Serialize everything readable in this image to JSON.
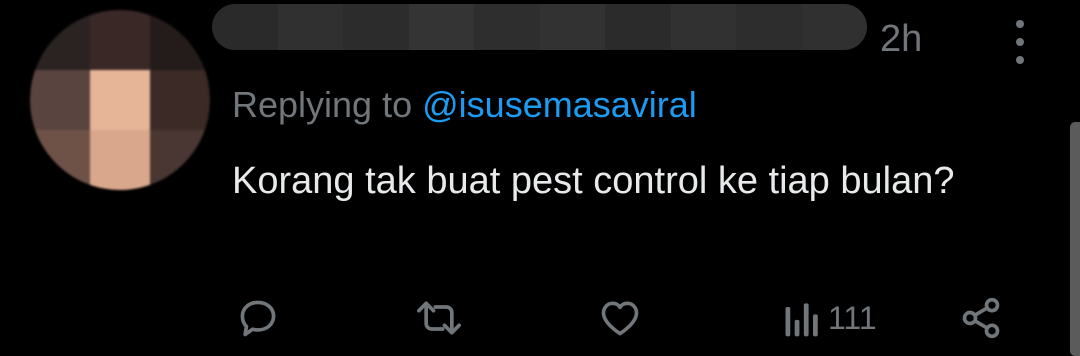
{
  "tweet": {
    "time": "2h",
    "replying_prefix": "Replying to",
    "replying_handle": "@isusemasaviral",
    "text": "Korang tak buat pest control ke tiap bulan?",
    "views": "111"
  },
  "icons": {
    "reply": "comment-bubble-icon",
    "retweet": "retweet-icon",
    "like": "heart-icon",
    "views": "bar-chart-icon",
    "share": "share-icon",
    "more": "more-vertical-icon"
  },
  "colors": {
    "background": "#000000",
    "text": "#e7e9ea",
    "muted": "#71767b",
    "link": "#1d9bf0"
  }
}
